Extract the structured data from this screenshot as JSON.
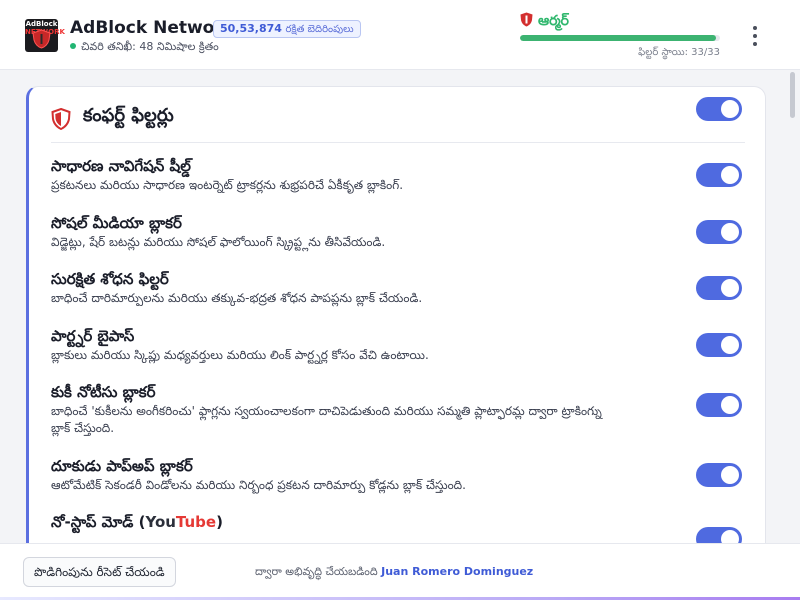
{
  "header": {
    "logo_text": "AdBlock",
    "logo_subtext": "NETWORK",
    "title": "AdBlock Network",
    "blocked_count": "50,53,874",
    "blocked_label": "రక్షిత బెదిరింపులు",
    "last_check": "చివరి తనిఖీ: 48 నిమిషాల క్రితం",
    "armor_label": "ఆర్మర్",
    "armor_progress": 0.98,
    "filter_level": "ఫిల్టర్ స్థాయి: 33/33"
  },
  "card": {
    "title": "కంఫర్ట్ ఫిల్టర్లు",
    "enabled": true
  },
  "filters": [
    {
      "name": "సాధారణ నావిగేషన్ షీల్డ్",
      "desc": "ప్రకటనలు మరియు సాధారణ ఇంటర్నెట్ ట్రాకర్లను శుభ్రపరిచే ఏకీకృత బ్లాకింగ్.",
      "enabled": true
    },
    {
      "name": "సోషల్ మీడియా బ్లాకర్",
      "desc": "విడ్జెట్లు, షేర్ బటన్లు మరియు సోషల్ ఫాలోయింగ్ స్క్రిప్ట్లను తీసివేయండి.",
      "enabled": true
    },
    {
      "name": "సురక్షిత శోధన ఫిల్టర్",
      "desc": "బాధించే దారిమార్పులను మరియు తక్కువ-భద్రత శోధన పాపప్లను బ్లాక్ చేయండి.",
      "enabled": true
    },
    {
      "name": "పార్ట్నర్ బైపాస్",
      "desc": "బ్లాకులు మరియు స్కిప్లు మధ్యవర్తులు మరియు లింక్ పార్ట్నర్ల కోసం వేచి ఉంటాయి.",
      "enabled": true
    },
    {
      "name": "కుకీ నోటీసు బ్లాకర్",
      "desc": "బాధించే 'కుకీలను అంగీకరించు' ఫ్లాగ్లను స్వయంచాలకంగా దాచిపెడుతుంది మరియు సమ్మతి ప్లాట్ఫారమ్ల ద్వారా ట్రాకింగ్ను బ్లాక్ చేస్తుంది.",
      "enabled": true
    },
    {
      "name": "దూకుడు పాప్అప్ బ్లాకర్",
      "desc": "ఆటోమేటిక్ సెకండరీ విండోలను మరియు నిర్బంధ ప్రకటన దారిమార్పు కోడ్లను బ్లాక్ చేస్తుంది.",
      "enabled": true
    },
    {
      "name_prefix": "నో-స్టాప్ మోడ్ (",
      "name_you": "You",
      "name_tube": "Tube",
      "name_suffix": ")",
      "enabled": true
    }
  ],
  "footer": {
    "reset_label": "పొడిగింపును రీసెట్ చేయండి",
    "credit_prefix": "ద్వారా అభివృద్ధి చేయబడింది",
    "author": "Juan Romero Dominguez"
  },
  "colors": {
    "accent": "#4f6ae0",
    "armor_green": "#2fb76d",
    "youtube_red": "#e53935"
  }
}
